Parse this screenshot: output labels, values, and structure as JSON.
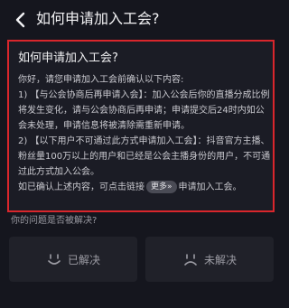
{
  "header": {
    "title": "如何申请加入工会?",
    "back_icon": "chevron-left-icon"
  },
  "card": {
    "title": "如何申请加入工会?",
    "lines": [
      "你好，请您申请加入工会前确认以下内容:",
      "1) 【与公会协商后再申请入会】：加入公会后你的直播分成比例将发生变化，请与公会协商后再申请；申请提交后24时内如公会未处理，申请信息将被清除需重新申请。",
      "2) 【以下用户不可通过此方式申请加入工会】：抖音官方主播、粉丝量100万以上的用户和已经是公会主播身份的用户，不可通过此方式加入公会。"
    ],
    "final_prefix": "如已确认上述内容，可点击链接",
    "final_link": "更多»",
    "final_suffix": "申请加入工会。"
  },
  "feedback": {
    "question": "你的问题是否被解决?",
    "resolved_label": "已解决",
    "unresolved_label": "未解决",
    "resolved_icon": "smile-icon",
    "unresolved_icon": "frown-icon"
  },
  "colors": {
    "background": "#15161e",
    "highlight_border": "#d9262c",
    "chip": "#4a4b55"
  }
}
